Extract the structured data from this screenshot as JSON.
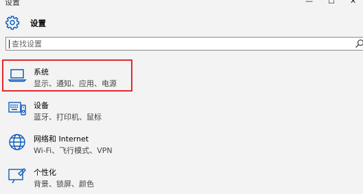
{
  "window": {
    "title": "设置",
    "minimize": "—",
    "maximize": "☐",
    "close": "✕"
  },
  "header": {
    "title": "设置",
    "icon": "gear-icon"
  },
  "search": {
    "placeholder": "查找设置",
    "value": "",
    "icon": "search-icon"
  },
  "items": [
    {
      "name": "系统",
      "desc": "显示、通知、应用、电源",
      "icon": "laptop-icon",
      "highlighted": true
    },
    {
      "name": "设备",
      "desc": "蓝牙、打印机、鼠标",
      "icon": "devices-icon"
    },
    {
      "name": "网络和 Internet",
      "desc": "Wi-Fi、飞行模式、VPN",
      "icon": "globe-icon"
    },
    {
      "name": "个性化",
      "desc": "背景、锁屏、颜色",
      "icon": "personalization-icon"
    }
  ],
  "colors": {
    "accent": "#0a5bbd",
    "highlight_border": "#e3262b"
  }
}
